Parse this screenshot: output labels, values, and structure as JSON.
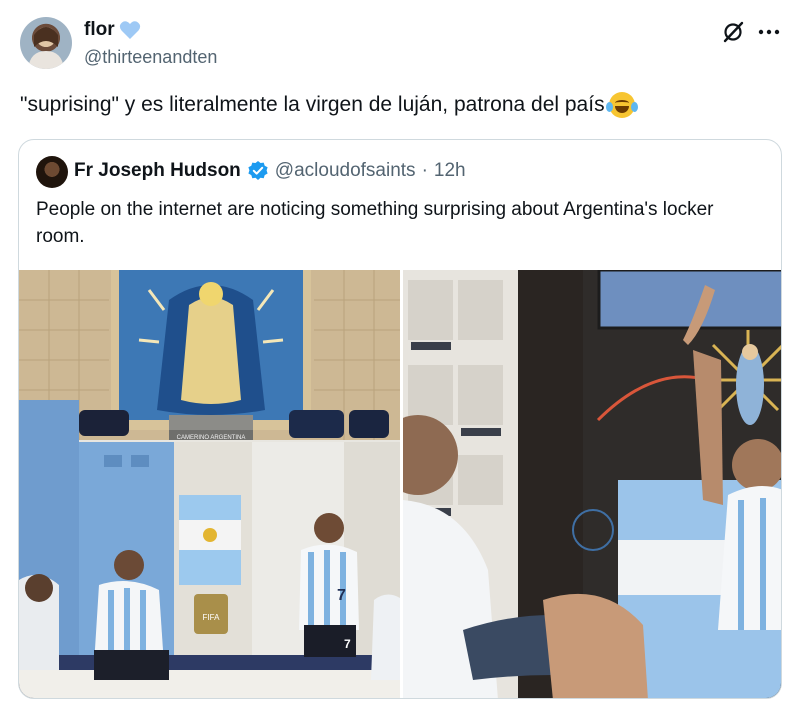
{
  "tweet": {
    "display_name": "flor",
    "handle": "@thirteenandten",
    "text": "\"suprising\" y es literalmente la virgen de luján, patrona del país",
    "emoji": "face-with-tears-of-joy-emoji"
  },
  "quoted": {
    "name": "Fr Joseph Hudson",
    "handle": "@acloudofsaints",
    "separator": "·",
    "time": "12h",
    "text": "People on the internet are noticing something surprising about Argentina's locker room.",
    "photos": [
      {
        "sign": "CAMERINO ARGENTINA",
        "badge": "FIFA",
        "numbers": [
          "7",
          "7"
        ]
      },
      {
        "numbers": []
      }
    ]
  },
  "colors": {
    "verified": "#1d9bf0",
    "heart": "#9ec9f5",
    "secondary_text": "#536471",
    "arrow": "#d9563a",
    "argentina_blue": "#74acdf"
  },
  "icons": [
    "heart-icon",
    "grok-icon",
    "more-icon",
    "verified-badge-icon"
  ]
}
